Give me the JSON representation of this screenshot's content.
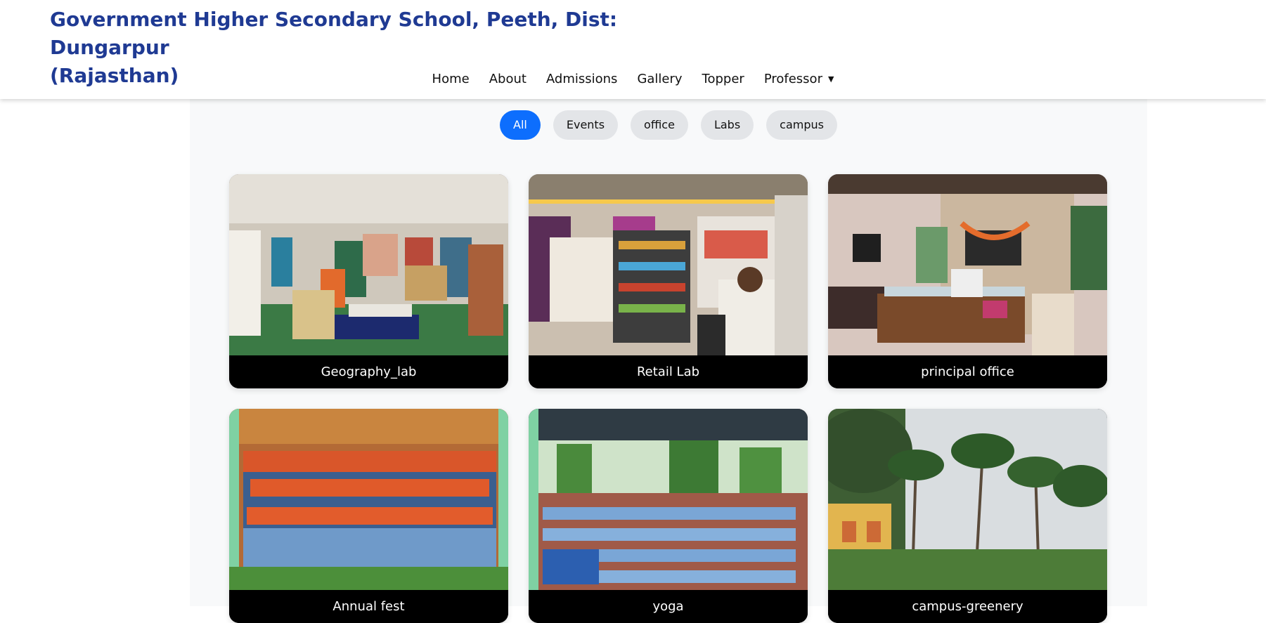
{
  "site": {
    "title_line1": "Government Higher Secondary School, Peeth, Dist: Dungarpur",
    "title_line2": "(Rajasthan)"
  },
  "nav": {
    "items": [
      {
        "label": "Home"
      },
      {
        "label": "About"
      },
      {
        "label": "Admissions"
      },
      {
        "label": "Gallery"
      },
      {
        "label": "Topper"
      },
      {
        "label": "Professor"
      }
    ],
    "dropdown_icon": "caret-down-icon"
  },
  "filters": [
    {
      "label": "All",
      "active": true
    },
    {
      "label": "Events",
      "active": false
    },
    {
      "label": "office",
      "active": false
    },
    {
      "label": "Labs",
      "active": false
    },
    {
      "label": "campus",
      "active": false
    }
  ],
  "gallery": [
    {
      "caption": "Geography_lab"
    },
    {
      "caption": "Retail Lab"
    },
    {
      "caption": "principal office"
    },
    {
      "caption": "Annual fest"
    },
    {
      "caption": "yoga"
    },
    {
      "caption": "campus-greenery"
    }
  ],
  "colors": {
    "title": "#1f3a93",
    "active_filter": "#0d6efd",
    "filter_bg": "#e3e5e8",
    "content_bg": "#f8f9fa"
  }
}
